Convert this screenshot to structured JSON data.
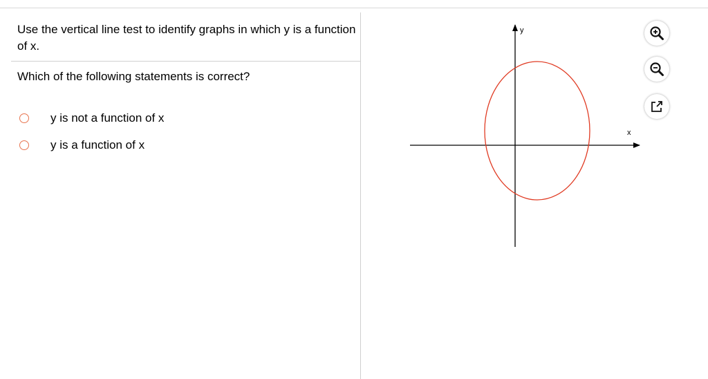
{
  "question": {
    "prompt": "Use the vertical line test to identify graphs in which y is a function of x.",
    "text": "Which of the following statements is correct?",
    "options": [
      {
        "label": "y is not a function of x",
        "selected": false
      },
      {
        "label": "y is a function of x",
        "selected": false
      }
    ]
  },
  "graph": {
    "x_axis_label": "x",
    "y_axis_label": "y",
    "curve_color": "#e03a22",
    "axis_color": "#000000"
  },
  "toolbar": {
    "zoom_in_icon": "zoom-in-icon",
    "zoom_out_icon": "zoom-out-icon",
    "popout_icon": "external-link-icon"
  },
  "colors": {
    "radio_border": "#e8734e",
    "divider": "#cfcfcf"
  }
}
